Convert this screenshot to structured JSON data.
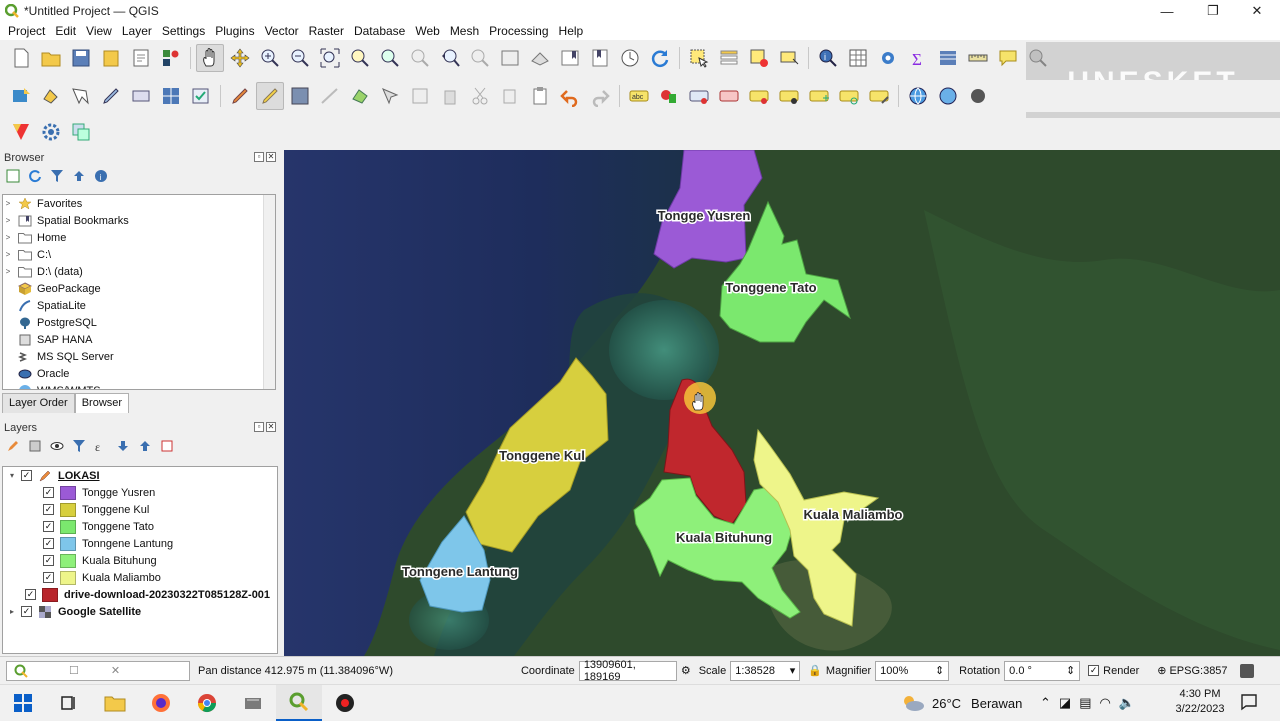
{
  "window": {
    "title": "*Untitled Project — QGIS",
    "minimize": "—",
    "maximize": "❐",
    "close": "✕"
  },
  "menu": [
    "Project",
    "Edit",
    "View",
    "Layer",
    "Settings",
    "Plugins",
    "Vector",
    "Raster",
    "Database",
    "Web",
    "Mesh",
    "Processing",
    "Help"
  ],
  "watermark_text": "UNESKET",
  "browser_panel": {
    "title": "Browser",
    "items": [
      {
        "label": "Favorites",
        "icon": "star-icon",
        "expand": true
      },
      {
        "label": "Spatial Bookmarks",
        "icon": "bookmark-icon",
        "expand": true
      },
      {
        "label": "Home",
        "icon": "folder-icon",
        "expand": true
      },
      {
        "label": "C:\\",
        "icon": "folder-icon",
        "expand": true
      },
      {
        "label": "D:\\ (data)",
        "icon": "folder-icon",
        "expand": true
      },
      {
        "label": "GeoPackage",
        "icon": "geopackage-icon",
        "expand": false
      },
      {
        "label": "SpatiaLite",
        "icon": "spatialite-icon",
        "expand": false
      },
      {
        "label": "PostgreSQL",
        "icon": "postgresql-icon",
        "expand": false
      },
      {
        "label": "SAP HANA",
        "icon": "saphana-icon",
        "expand": false
      },
      {
        "label": "MS SQL Server",
        "icon": "mssql-icon",
        "expand": false
      },
      {
        "label": "Oracle",
        "icon": "oracle-icon",
        "expand": false
      },
      {
        "label": "WMS/WMTS",
        "icon": "wms-icon",
        "expand": false
      }
    ]
  },
  "tabs": {
    "layer_order": "Layer Order",
    "browser": "Browser"
  },
  "layers_panel": {
    "title": "Layers",
    "group": {
      "label": "LOKASI"
    },
    "children": [
      {
        "label": "Tongge Yusren",
        "color": "#9b5ad6"
      },
      {
        "label": "Tonggene Kul",
        "color": "#d7cf3e"
      },
      {
        "label": "Tonggene Tato",
        "color": "#7be86e"
      },
      {
        "label": "Tonngene Lantung",
        "color": "#7ec6ea"
      },
      {
        "label": "Kuala Bituhung",
        "color": "#8ef07a"
      },
      {
        "label": "Kuala Maliambo",
        "color": "#eef58a"
      }
    ],
    "raster": {
      "label": "drive-download-20230322T085128Z-001",
      "color": "#b8252b"
    },
    "basemap": {
      "label": "Google Satellite"
    }
  },
  "map": {
    "labels": {
      "tongge_yusren": "Tongge Yusren",
      "tonggene_tato": "Tonggene Tato",
      "tonggene_kul": "Tonggene Kul",
      "kuala_maliambo": "Kuala Maliambo",
      "kuala_bituhung": "Kuala Bituhung",
      "tonngene_lantung": "Tonngene Lantung"
    },
    "red_area_color": "#c0272d"
  },
  "status": {
    "message": "Pan distance 412.975 m (11.384096°W)",
    "coordinate_label": "Coordinate",
    "coordinate_value": "13909601, 189169",
    "scale_label": "Scale",
    "scale_value": "1:38528",
    "magnifier_label": "Magnifier",
    "magnifier_value": "100%",
    "rotation_label": "Rotation",
    "rotation_value": "0.0 °",
    "render_label": "Render",
    "crs": "EPSG:3857"
  },
  "taskbar": {
    "weather": "26°C",
    "weather_text": "Berawan",
    "time": "4:30 PM",
    "date": "3/22/2023"
  }
}
